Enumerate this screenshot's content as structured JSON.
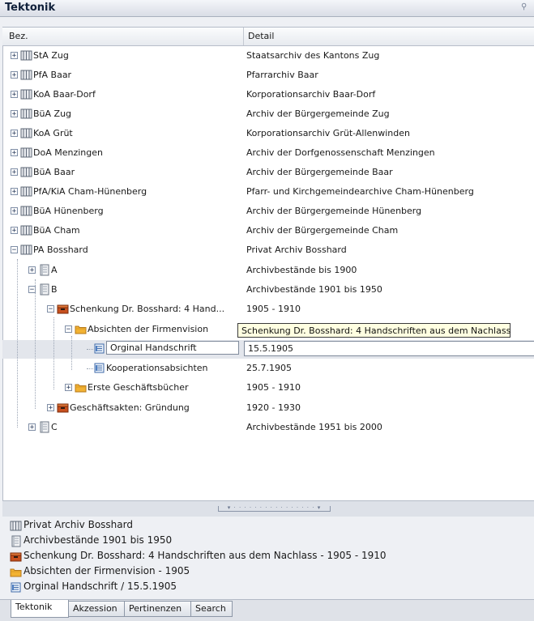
{
  "window": {
    "title": "Tektonik"
  },
  "columns": {
    "bez": "Bez.",
    "detail": "Detail"
  },
  "rows": [
    {
      "bez": "StA Zug",
      "detail": "Staatsarchiv des Kantons Zug",
      "expander": "+",
      "icon": "archive-icon"
    },
    {
      "bez": "PfA Baar",
      "detail": "Pfarrarchiv Baar",
      "expander": "+",
      "icon": "archive-icon"
    },
    {
      "bez": "KoA Baar-Dorf",
      "detail": "Korporationsarchiv Baar-Dorf",
      "expander": "+",
      "icon": "archive-icon"
    },
    {
      "bez": "BüA Zug",
      "detail": "Archiv der Bürgergemeinde Zug",
      "expander": "+",
      "icon": "archive-icon"
    },
    {
      "bez": "KoA Grüt",
      "detail": "Korporationsarchiv Grüt-Allenwinden",
      "expander": "+",
      "icon": "archive-icon"
    },
    {
      "bez": "DoA Menzingen",
      "detail": "Archiv der Dorfgenossenschaft Menzingen",
      "expander": "+",
      "icon": "archive-icon"
    },
    {
      "bez": "BüA Baar",
      "detail": "Archiv der Bürgergemeinde Baar",
      "expander": "+",
      "icon": "archive-icon"
    },
    {
      "bez": "PfA/KiA Cham-Hünenberg",
      "detail": "Pfarr- und Kirchgemeindearchive Cham-Hünenberg",
      "expander": "+",
      "icon": "archive-icon"
    },
    {
      "bez": "BüA Hünenberg",
      "detail": "Archiv der Bürgergemeinde Hünenberg",
      "expander": "+",
      "icon": "archive-icon"
    },
    {
      "bez": "BüA Cham",
      "detail": "Archiv der Bürgergemeinde Cham",
      "expander": "+",
      "icon": "archive-icon"
    },
    {
      "bez": "PA Bosshard",
      "detail": "Privat Archiv Bosshard",
      "expander": "−",
      "icon": "archive-icon"
    },
    {
      "bez": "A",
      "detail": "Archivbestände bis 1900",
      "expander": "+",
      "icon": "binder-icon"
    },
    {
      "bez": "B",
      "detail": "Archivbestände 1901 bis 1950",
      "expander": "−",
      "icon": "binder-icon"
    },
    {
      "bez": "Schenkung Dr. Bosshard: 4 Hand...",
      "detail": "1905 - 1910",
      "expander": "−",
      "icon": "box-icon"
    },
    {
      "bez": "Absichten der Firmenvision",
      "detail": "",
      "expander": "−",
      "icon": "folder-icon"
    },
    {
      "bez": "Orginal Handschrift",
      "detail": "15.5.1905",
      "expander": "",
      "icon": "document-icon"
    },
    {
      "bez": "Kooperationsabsichten",
      "detail": "25.7.1905",
      "expander": "",
      "icon": "document-icon"
    },
    {
      "bez": "Erste Geschäftsbücher",
      "detail": "1905 - 1910",
      "expander": "+",
      "icon": "folder-icon"
    },
    {
      "bez": "Geschäftsakten: Gründung",
      "detail": "1920 - 1930",
      "expander": "+",
      "icon": "box-icon"
    },
    {
      "bez": "C",
      "detail": "Archivbestände 1951 bis 2000",
      "expander": "+",
      "icon": "binder-icon"
    }
  ],
  "tooltip": "Schenkung Dr. Bosshard: 4 Handschriften aus dem Nachlass",
  "breadcrumbs": [
    {
      "text": "Privat Archiv Bosshard",
      "icon": "archive-icon"
    },
    {
      "text": "Archivbestände 1901 bis 1950",
      "icon": "binder-icon"
    },
    {
      "text": "Schenkung Dr. Bosshard: 4 Handschriften aus dem Nachlass - 1905 - 1910",
      "icon": "box-icon"
    },
    {
      "text": "Absichten der Firmenvision - 1905",
      "icon": "folder-icon"
    },
    {
      "text": "Orginal Handschrift / 15.5.1905",
      "icon": "document-icon"
    }
  ],
  "tabs": [
    "Tektonik",
    "Akzession",
    "Pertinenzen",
    "Search"
  ],
  "colors": {
    "selection": "#e3e6ec",
    "tooltip_bg": "#ffffe1",
    "folder": "#f2b233",
    "box": "#c8501e"
  }
}
